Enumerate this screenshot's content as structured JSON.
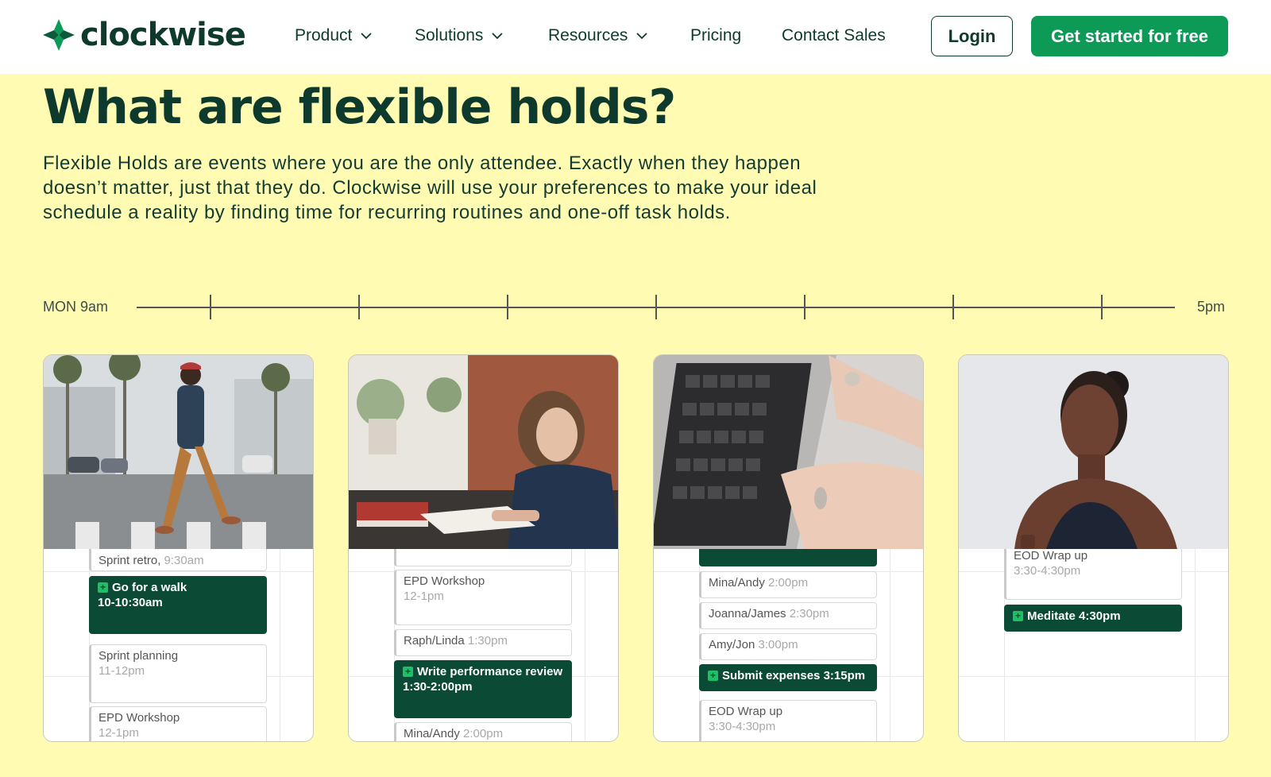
{
  "brand": {
    "name": "clockwise"
  },
  "nav": {
    "items": [
      {
        "label": "Product",
        "has_dropdown": true
      },
      {
        "label": "Solutions",
        "has_dropdown": true
      },
      {
        "label": "Resources",
        "has_dropdown": true
      },
      {
        "label": "Pricing",
        "has_dropdown": false
      },
      {
        "label": "Contact Sales",
        "has_dropdown": false
      }
    ],
    "login_label": "Login",
    "cta_label": "Get started for free"
  },
  "hero": {
    "heading": "What are flexible holds?",
    "description": "Flexible Holds are events where you are the only attendee. Exactly when they happen doesn’t matter, just that they do. Clockwise will use your preferences to make your ideal schedule a reality by finding time for recurring routines and one-off task holds."
  },
  "timeline": {
    "start_label": "MON 9am",
    "end_label": "5pm"
  },
  "cards": [
    {
      "photo": "person-walking-street-photo",
      "events": [
        {
          "title": "Sprint retro,",
          "time": "9:30am"
        },
        {
          "title": "Sprint planning",
          "time": "11-12pm"
        },
        {
          "title": "EPD Workshop",
          "time": "12-1pm"
        }
      ],
      "hold": {
        "title": "Go for a walk",
        "time": "10-10:30am"
      }
    },
    {
      "photo": "woman-writing-notebook-photo",
      "events": [
        {
          "title": "EPD Workshop",
          "time": "12-1pm"
        },
        {
          "title": "Raph/Linda",
          "time": "1:30pm"
        },
        {
          "title": "Mina/Andy",
          "time": "2:00pm"
        }
      ],
      "hold": {
        "title": "Write performance review",
        "time": "1:30-2:00pm"
      }
    },
    {
      "photo": "hands-typing-laptop-photo",
      "events": [
        {
          "title": "Mina/Andy",
          "time": "2:00pm"
        },
        {
          "title": "Joanna/James",
          "time": "2:30pm"
        },
        {
          "title": "Amy/Jon",
          "time": "3:00pm"
        },
        {
          "title": "EOD Wrap up",
          "time": "3:30-4:30pm"
        }
      ],
      "hold": {
        "title": "Submit expenses",
        "time": "3:15pm"
      }
    },
    {
      "photo": "woman-meditating-photo",
      "events": [
        {
          "title": "EOD Wrap up",
          "time": "3:30-4:30pm"
        }
      ],
      "hold": {
        "title": "Meditate",
        "time": "4:30pm"
      }
    }
  ],
  "colors": {
    "page_bg": "#fffbb3",
    "brand_dark": "#0e3a2e",
    "cta_green": "#0d9a56",
    "hold_green": "#0b4a35"
  }
}
